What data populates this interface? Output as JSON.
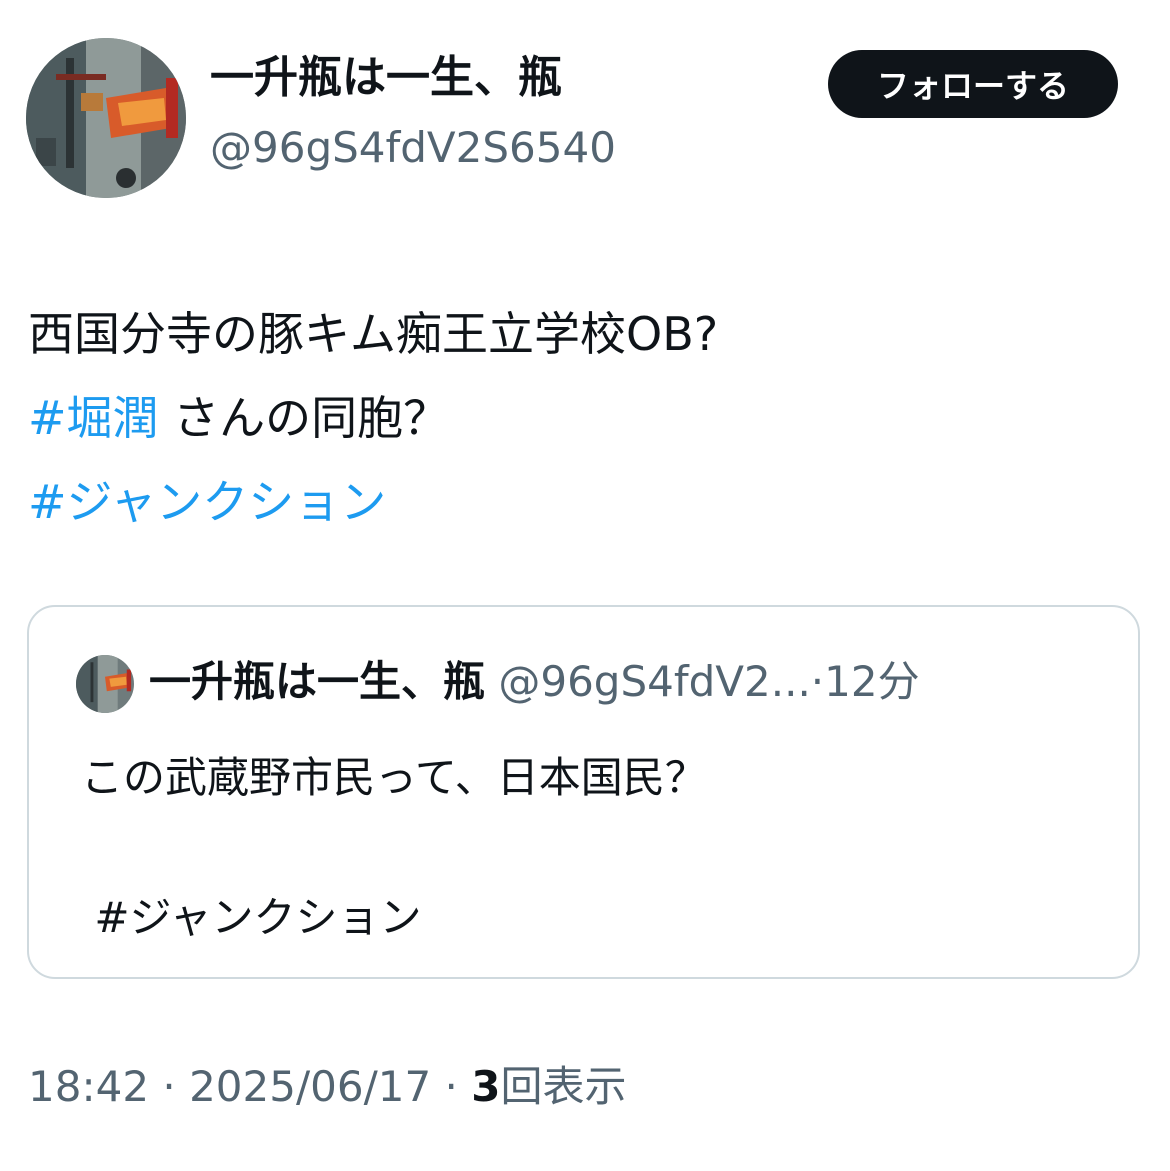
{
  "author": {
    "display_name": "一升瓶は一生、瓶",
    "handle": "@96gS4fdV2S6540"
  },
  "follow_button_label": "フォローする",
  "tweet": {
    "line1": "西国分寺の豚キム痴王立学校OB?",
    "hashtag1": "#堀潤",
    "line2_rest": " さんの同胞？",
    "hashtag2": "#ジャンクション"
  },
  "quoted_tweet": {
    "display_name": "一升瓶は一生、瓶",
    "meta": " @96gS4fdV2...·12分",
    "text": "この武蔵野市民って、日本国民？",
    "hashtag": "#ジャンクション"
  },
  "footer": {
    "time_date": "18:42 · 2025/06/17 · ",
    "views_count": "3",
    "views_label": "回表示"
  },
  "colors": {
    "link": "#1d9bf0",
    "secondary_text": "#536471",
    "primary_text": "#0f1419",
    "border": "#cfd9de"
  }
}
